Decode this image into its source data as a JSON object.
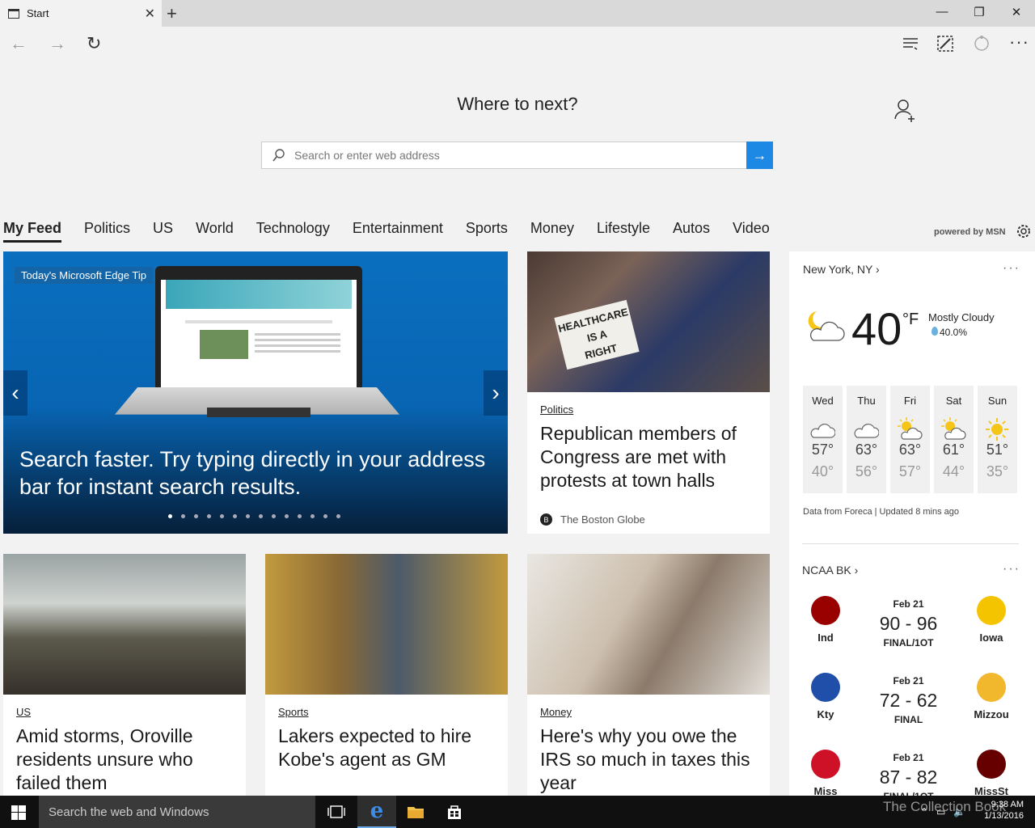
{
  "browser": {
    "tab_title": "Start",
    "new_tab": "+",
    "minimize": "—",
    "restore": "❐",
    "close": "✕"
  },
  "start": {
    "headline": "Where to next?",
    "search_placeholder": "Search or enter web address"
  },
  "categories": [
    "My Feed",
    "Politics",
    "US",
    "World",
    "Technology",
    "Entertainment",
    "Sports",
    "Money",
    "Lifestyle",
    "Autos",
    "Video"
  ],
  "powered_by": "powered by MSN",
  "hero": {
    "tag": "Today's Microsoft Edge Tip",
    "title": "Search faster. Try typing directly in your address bar for instant search results.",
    "page_count": 14,
    "active_index": 0
  },
  "cards": [
    {
      "category": "Politics",
      "title": "Republican members of Congress are met with protests at town halls",
      "source": "The Boston Globe"
    },
    {
      "category": "US",
      "title": "Amid storms, Oroville residents unsure who failed them"
    },
    {
      "category": "Sports",
      "title": "Lakers expected to hire Kobe's agent as GM"
    },
    {
      "category": "Money",
      "title": "Here's why you owe the IRS so much in taxes this year"
    }
  ],
  "weather": {
    "location": "New York, NY",
    "temp": "40",
    "unit": "°F",
    "condition": "Mostly Cloudy",
    "precip": "40.0%",
    "forecast": [
      {
        "day": "Wed",
        "hi": "57°",
        "lo": "40°",
        "icon": "cloudy-icon"
      },
      {
        "day": "Thu",
        "hi": "63°",
        "lo": "56°",
        "icon": "cloudy-icon"
      },
      {
        "day": "Fri",
        "hi": "63°",
        "lo": "57°",
        "icon": "partly-sunny-icon"
      },
      {
        "day": "Sat",
        "hi": "61°",
        "lo": "44°",
        "icon": "partly-sunny-icon"
      },
      {
        "day": "Sun",
        "hi": "51°",
        "lo": "35°",
        "icon": "sunny-icon"
      }
    ],
    "footer": "Data from Foreca | Updated 8 mins ago"
  },
  "ncaa": {
    "title": "NCAA BK",
    "games": [
      {
        "date": "Feb 21",
        "score": "90 - 96",
        "status": "FINAL/1OT",
        "home": "Ind",
        "away": "Iowa",
        "home_color": "#990000",
        "away_color": "#f5c400"
      },
      {
        "date": "Feb 21",
        "score": "72 - 62",
        "status": "FINAL",
        "home": "Kty",
        "away": "Mizzou",
        "home_color": "#1f4fa8",
        "away_color": "#f1b82d"
      },
      {
        "date": "Feb 21",
        "score": "87 - 82",
        "status": "FINAL/1OT",
        "home": "Miss",
        "away": "MissSt",
        "home_color": "#ce1126",
        "away_color": "#660000"
      }
    ]
  },
  "taskbar": {
    "search_text": "Search the web and Windows",
    "time": "9:38 AM",
    "date": "1/13/2016"
  },
  "watermark": "The Collection Book"
}
